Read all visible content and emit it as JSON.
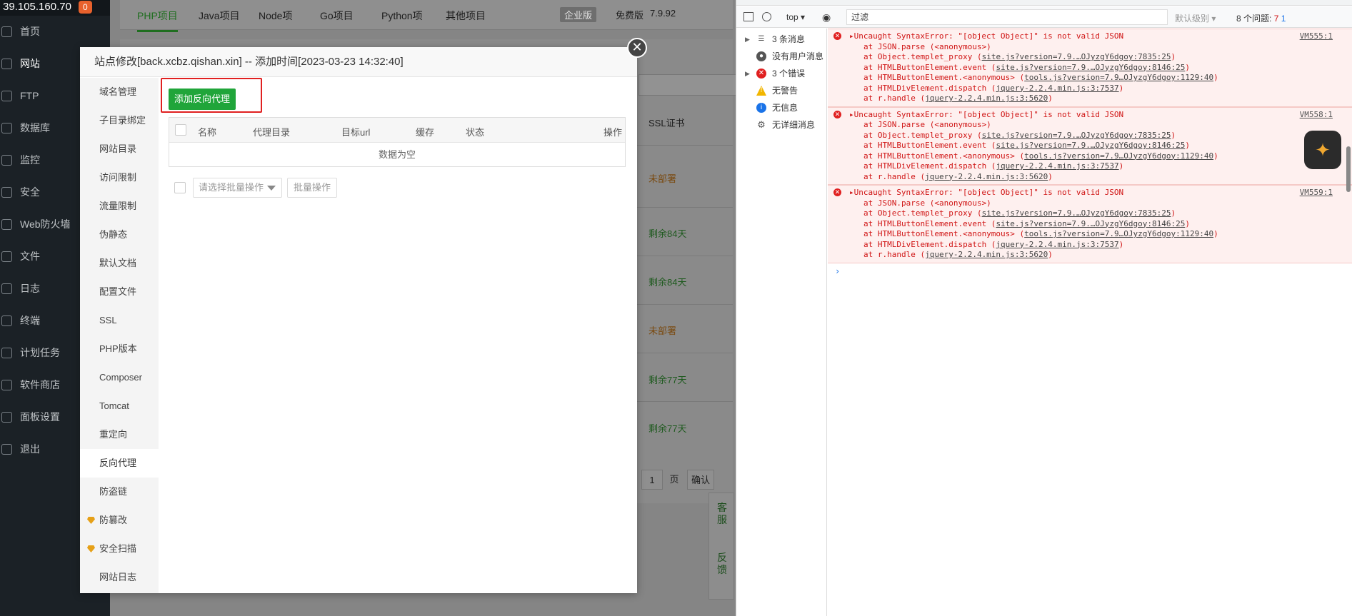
{
  "app": {
    "server_ip": "39.105.160.70",
    "notify_count": "0",
    "sidebar": [
      {
        "label": "首页"
      },
      {
        "label": "网站"
      },
      {
        "label": "FTP"
      },
      {
        "label": "数据库"
      },
      {
        "label": "监控"
      },
      {
        "label": "安全"
      },
      {
        "label": "Web防火墙"
      },
      {
        "label": "文件"
      },
      {
        "label": "日志"
      },
      {
        "label": "终端"
      },
      {
        "label": "计划任务"
      },
      {
        "label": "软件商店"
      },
      {
        "label": "面板设置"
      },
      {
        "label": "退出"
      }
    ],
    "tabs": [
      "PHP项目",
      "Java项目",
      "Node项",
      "Go项目",
      "Python项",
      "其他项目"
    ],
    "edition": "企业版",
    "free": "免费版",
    "version": "7.9.92",
    "ssl_header": "SSL证书",
    "ssl_rows": [
      "未部署",
      "剩余84天",
      "剩余84天",
      "未部署",
      "剩余77天",
      "剩余77天"
    ],
    "page_num": "1",
    "page_word": "页",
    "confirm": "确认",
    "float_service": "客服",
    "float_feedback": "反馈"
  },
  "modal": {
    "title": "站点修改[back.xcbz.qishan.xin] -- 添加时间[2023-03-23 14:32:40]",
    "close": "✕",
    "menu": [
      {
        "label": "域名管理"
      },
      {
        "label": "子目录绑定"
      },
      {
        "label": "网站目录"
      },
      {
        "label": "访问限制"
      },
      {
        "label": "流量限制"
      },
      {
        "label": "伪静态"
      },
      {
        "label": "默认文档"
      },
      {
        "label": "配置文件"
      },
      {
        "label": "SSL"
      },
      {
        "label": "PHP版本"
      },
      {
        "label": "Composer"
      },
      {
        "label": "Tomcat"
      },
      {
        "label": "重定向"
      },
      {
        "label": "反向代理"
      },
      {
        "label": "防盗链"
      },
      {
        "label": "防篡改"
      },
      {
        "label": "安全扫描"
      },
      {
        "label": "网站日志"
      }
    ],
    "add_button": "添加反向代理",
    "columns": [
      "名称",
      "代理目录",
      "目标url",
      "缓存",
      "状态",
      "操作"
    ],
    "empty": "数据为空",
    "bulk_placeholder": "请选择批量操作",
    "bulk_button": "批量操作"
  },
  "devtools": {
    "context": "top",
    "filter": "过滤",
    "level": "默认级别",
    "issues": "8 个问题:",
    "issues_err": "7",
    "issues_info": "1",
    "left": [
      {
        "label": "3 条消息"
      },
      {
        "label": "没有用户消息"
      },
      {
        "label": "3 个错误"
      },
      {
        "label": "无警告"
      },
      {
        "label": "无信息"
      },
      {
        "label": "无详细消息"
      }
    ],
    "errors": [
      {
        "msg": "Uncaught SyntaxError: \"[object Object]\" is not valid JSON",
        "src": "VM555:1",
        "stack": [
          [
            "at JSON.parse (<anonymous>)",
            ""
          ],
          [
            "at Object.templet_proxy (",
            "site.js?version=7.9.…OJyzgY6dgoy:7835:25",
            ")"
          ],
          [
            "at HTMLButtonElement.event (",
            "site.js?version=7.9.…OJyzgY6dgoy:8146:25",
            ")"
          ],
          [
            "at HTMLButtonElement.<anonymous> (",
            "tools.js?version=7.9…OJyzgY6dgoy:1129:40",
            ")"
          ],
          [
            "at HTMLDivElement.dispatch (",
            "jquery-2.2.4.min.js:3:7537",
            ")"
          ],
          [
            "at r.handle (",
            "jquery-2.2.4.min.js:3:5620",
            ")"
          ]
        ]
      },
      {
        "msg": "Uncaught SyntaxError: \"[object Object]\" is not valid JSON",
        "src": "VM558:1",
        "stack": [
          [
            "at JSON.parse (<anonymous>)",
            ""
          ],
          [
            "at Object.templet_proxy (",
            "site.js?version=7.9.…OJyzgY6dgoy:7835:25",
            ")"
          ],
          [
            "at HTMLButtonElement.event (",
            "site.js?version=7.9.…OJyzgY6dgoy:8146:25",
            ")"
          ],
          [
            "at HTMLButtonElement.<anonymous> (",
            "tools.js?version=7.9…OJyzgY6dgoy:1129:40",
            ")"
          ],
          [
            "at HTMLDivElement.dispatch (",
            "jquery-2.2.4.min.js:3:7537",
            ")"
          ],
          [
            "at r.handle (",
            "jquery-2.2.4.min.js:3:5620",
            ")"
          ]
        ]
      },
      {
        "msg": "Uncaught SyntaxError: \"[object Object]\" is not valid JSON",
        "src": "VM559:1",
        "stack": [
          [
            "at JSON.parse (<anonymous>)",
            ""
          ],
          [
            "at Object.templet_proxy (",
            "site.js?version=7.9.…OJyzgY6dgoy:7835:25",
            ")"
          ],
          [
            "at HTMLButtonElement.event (",
            "site.js?version=7.9.…OJyzgY6dgoy:8146:25",
            ")"
          ],
          [
            "at HTMLButtonElement.<anonymous> (",
            "tools.js?version=7.9…OJyzgY6dgoy:1129:40",
            ")"
          ],
          [
            "at HTMLDivElement.dispatch (",
            "jquery-2.2.4.min.js:3:7537",
            ")"
          ],
          [
            "at r.handle (",
            "jquery-2.2.4.min.js:3:5620",
            ")"
          ]
        ]
      }
    ],
    "prompt": "›"
  }
}
